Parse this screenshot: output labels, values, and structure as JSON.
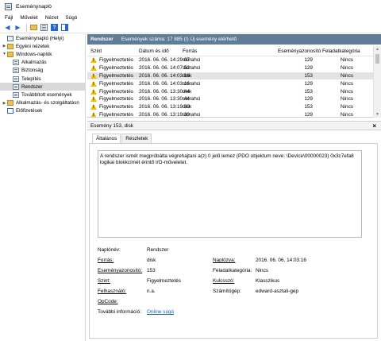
{
  "window": {
    "title": "Eseménynapló",
    "icon": "event-viewer-icon"
  },
  "menu": [
    "Fájl",
    "Művelet",
    "Nézet",
    "Súgó"
  ],
  "toolbar": {
    "icons": [
      "back-arrow-icon",
      "forward-arrow-icon",
      "open-folder-icon",
      "properties-icon",
      "help-icon",
      "action-pane-icon"
    ]
  },
  "tree": {
    "items": [
      {
        "label": "Eseménynapló (Helyi)",
        "level": 0,
        "twisty": "",
        "icon": "root"
      },
      {
        "label": "Egyéni nézetek",
        "level": 1,
        "twisty": "▶",
        "icon": "folder"
      },
      {
        "label": "Windows-naplók",
        "level": 1,
        "twisty": "▼",
        "icon": "folder"
      },
      {
        "label": "Alkalmazás",
        "level": 2,
        "twisty": "",
        "icon": "log"
      },
      {
        "label": "Biztonság",
        "level": 2,
        "twisty": "",
        "icon": "log"
      },
      {
        "label": "Telepítés",
        "level": 2,
        "twisty": "",
        "icon": "log"
      },
      {
        "label": "Rendszer",
        "level": 2,
        "twisty": "",
        "icon": "log",
        "selected": true
      },
      {
        "label": "Továbbított események",
        "level": 2,
        "twisty": "",
        "icon": "log"
      },
      {
        "label": "Alkalmazás- és szolgáltatásn",
        "level": 1,
        "twisty": "▶",
        "icon": "folder"
      },
      {
        "label": "Előfizetések",
        "level": 1,
        "twisty": "",
        "icon": "sub"
      }
    ]
  },
  "grid": {
    "log_name": "Rendszer",
    "event_count_text": "Események száma: 17 885 (!) Új esemény elérhető",
    "columns": [
      "Szint",
      "Dátum és idő",
      "Forrás",
      "Eseményazonosító",
      "Feladatkategória"
    ],
    "rows": [
      {
        "level": "Figyelmeztetés",
        "datetime": "2016. 06. 06. 14:29:07",
        "source": "storahci",
        "id": "129",
        "category": "Nincs"
      },
      {
        "level": "Figyelmeztetés",
        "datetime": "2016. 06. 06. 14:07:52",
        "source": "storahci",
        "id": "129",
        "category": "Nincs"
      },
      {
        "level": "Figyelmeztetés",
        "datetime": "2016. 06. 06. 14:03:16",
        "source": "disk",
        "id": "153",
        "category": "Nincs",
        "selected": true
      },
      {
        "level": "Figyelmeztetés",
        "datetime": "2016. 06. 06. 14:03:16",
        "source": "storahci",
        "id": "129",
        "category": "Nincs"
      },
      {
        "level": "Figyelmeztetés",
        "datetime": "2016. 06. 06. 13:30:44",
        "source": "disk",
        "id": "153",
        "category": "Nincs"
      },
      {
        "level": "Figyelmeztetés",
        "datetime": "2016. 06. 06. 13:30:44",
        "source": "storahci",
        "id": "129",
        "category": "Nincs"
      },
      {
        "level": "Figyelmeztetés",
        "datetime": "2016. 06. 06. 13:19:30",
        "source": "disk",
        "id": "153",
        "category": "Nincs"
      },
      {
        "level": "Figyelmeztetés",
        "datetime": "2016. 06. 06. 13:19:30",
        "source": "storahci",
        "id": "129",
        "category": "Nincs"
      }
    ]
  },
  "detail": {
    "title": "Esemény 153, disk",
    "close": "×",
    "tabs": [
      "Általános",
      "Részletek"
    ],
    "description": "A rendszer ismét megpróbálta végrehajtani a(z) 0 jelű lemez (PDO objektum neve: \\Device\\00000023) 0x3c7efa8 logikai blokkcímét érintő I/O-műveletet.",
    "fields": {
      "log_name_label": "Naplónév:",
      "log_name": "Rendszer",
      "source_label": "Forrás:",
      "source": "disk",
      "logged_label": "Naplózva:",
      "logged": "2016. 06. 06. 14:03:16",
      "event_id_label": "Eseményazonosító:",
      "event_id": "153",
      "task_label": "Feladatkategória:",
      "task": "Nincs",
      "level_label": "Szint:",
      "level": "Figyelmeztetés",
      "keywords_label": "Kulcsszó:",
      "keywords": "Klasszikus",
      "user_label": "Felhasználó:",
      "user": "n.a.",
      "computer_label": "Számítógép:",
      "computer": "edward-asztali-gep",
      "opcode_label": "OpCode:",
      "more_info_label": "További információ:",
      "more_info_link": "Online súgó"
    }
  }
}
